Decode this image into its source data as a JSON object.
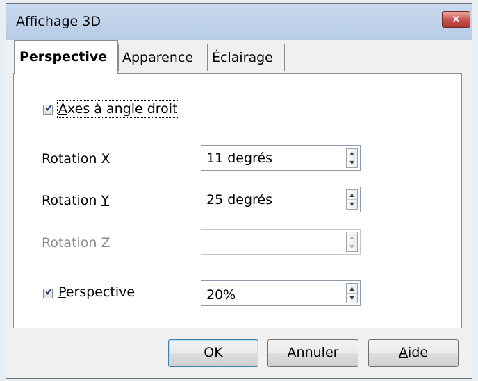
{
  "window": {
    "title": "Affichage 3D",
    "close_label": "✕"
  },
  "tabs": [
    {
      "label": "Perspective",
      "active": true
    },
    {
      "label": "Apparence",
      "active": false
    },
    {
      "label": "Éclairage",
      "active": false
    }
  ],
  "panel": {
    "right_angle_axes": {
      "checked": true,
      "label_mnemonic": "A",
      "label_rest": "xes à angle droit"
    },
    "rotation_x": {
      "label_prefix": "Rotation ",
      "label_mnemonic": "X",
      "value": "11 degrés"
    },
    "rotation_y": {
      "label_prefix": "Rotation ",
      "label_mnemonic": "Y",
      "value": "25 degrés"
    },
    "rotation_z": {
      "label_prefix": "Rotation ",
      "label_mnemonic": "Z",
      "value": "",
      "disabled": true
    },
    "perspective": {
      "checked": true,
      "label_mnemonic": "P",
      "label_rest": "erspective",
      "value": "20%"
    }
  },
  "buttons": {
    "ok": "OK",
    "cancel": "Annuler",
    "help_mnemonic": "A",
    "help_rest": "ide"
  },
  "colors": {
    "titlebar": "#b9cce6",
    "close_button": "#c75050",
    "default_button_border": "#3c7fb1"
  }
}
